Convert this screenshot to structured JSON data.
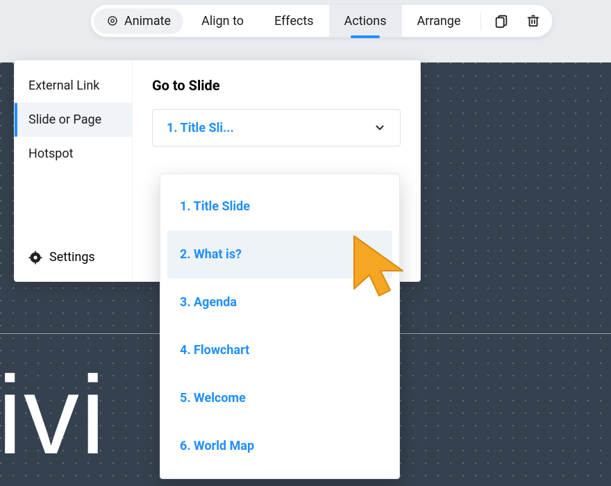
{
  "toolbar": {
    "animate": "Animate",
    "align": "Align to",
    "effects": "Effects",
    "actions": "Actions",
    "arrange": "Arrange"
  },
  "panel": {
    "sidebar": {
      "items": [
        {
          "label": "External Link"
        },
        {
          "label": "Slide or Page"
        },
        {
          "label": "Hotspot"
        }
      ],
      "settings_label": "Settings"
    },
    "title": "Go to Slide",
    "select_value": "1. Title Sli..."
  },
  "dropdown": {
    "options": [
      {
        "label": "1. Title Slide"
      },
      {
        "label": "2. What is?"
      },
      {
        "label": "3. Agenda"
      },
      {
        "label": "4. Flowchart"
      },
      {
        "label": "5. Welcome"
      },
      {
        "label": "6. World Map"
      }
    ],
    "hovered_index": 1
  },
  "slide_fragment": "tivi"
}
